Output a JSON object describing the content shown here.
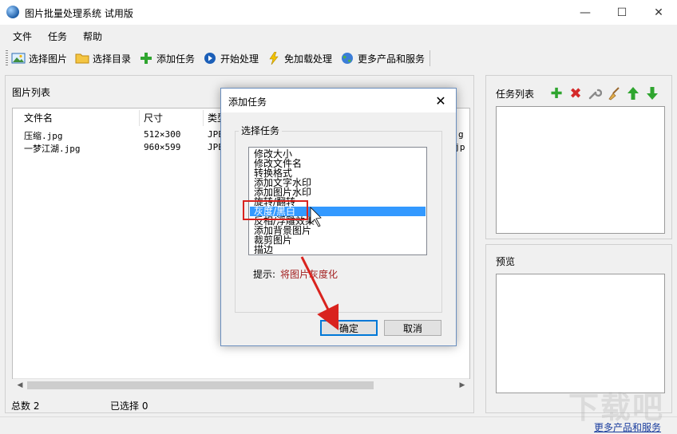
{
  "window": {
    "title": "图片批量处理系统 试用版",
    "minimize": "—",
    "maximize": "☐",
    "close": "✕"
  },
  "menu": [
    "文件",
    "任务",
    "帮助"
  ],
  "toolbar": {
    "select_image": "选择图片",
    "select_dir": "选择目录",
    "add_task": "添加任务",
    "start": "开始处理",
    "no_load": "免加载处理",
    "more": "更多产品和服务"
  },
  "file_list": {
    "title": "图片列表",
    "columns": [
      "文件名",
      "尺寸",
      "类型"
    ],
    "rows": [
      {
        "name": "压缩.jpg",
        "size": "512×300",
        "type": "JPEG",
        "tail": "g"
      },
      {
        "name": "一梦江湖.jpg",
        "size": "960×599",
        "type": "JPEG",
        "tail": "B.jp"
      }
    ]
  },
  "status": {
    "total": "总数  2",
    "selected": "已选择  0"
  },
  "task_panel": {
    "title": "任务列表"
  },
  "preview_panel": {
    "title": "预览"
  },
  "bottom_link": "更多产品和服务",
  "dialog": {
    "title": "添加任务",
    "group_label": "选择任务",
    "items": [
      "修改大小",
      "修改文件名",
      "转换格式",
      "添加文字水印",
      "添加图片水印",
      "旋转/翻转",
      "灰度/黑白",
      "反相/浮雕效果",
      "添加背景图片",
      "裁剪图片",
      "描边"
    ],
    "selected_index": 6,
    "hint_label": "提示:",
    "hint_text": "将图片灰度化",
    "ok": "确定",
    "cancel": "取消"
  },
  "watermark": "下载吧",
  "colors": {
    "selection": "#3399ff",
    "highlight": "#d9231e",
    "hint": "#a31f1f",
    "link": "#1a3d9e"
  }
}
